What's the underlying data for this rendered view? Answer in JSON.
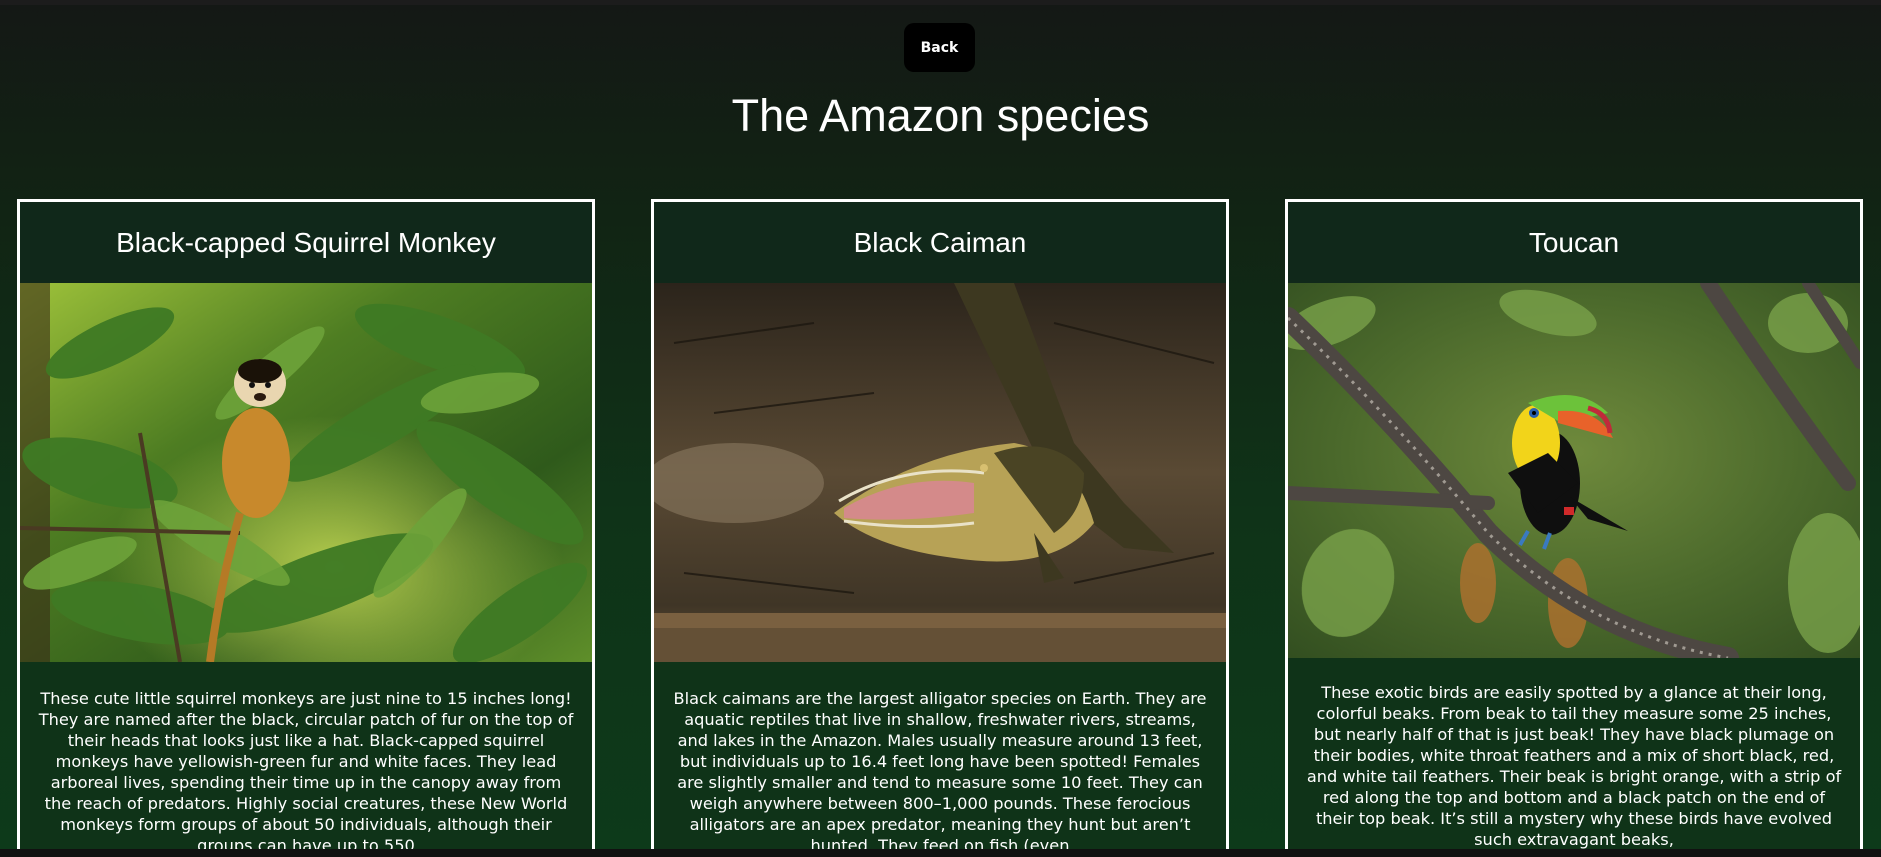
{
  "header": {
    "back_label": "Back",
    "title": "The Amazon species"
  },
  "cards": [
    {
      "title": "Black-capped Squirrel Monkey",
      "image": "squirrel-monkey-photo",
      "text": "These cute little squirrel monkeys are just nine to 15 inches long! They are named after the black, circular patch of fur on the top of their heads that looks just like a hat. Black-capped squirrel monkeys have yellowish-green fur and white faces. They lead arboreal lives, spending their time up in the canopy away from the reach of predators. Highly social creatures, these New World monkeys form groups of about 50 individuals, although their groups can have up to 550"
    },
    {
      "title": "Black Caiman",
      "image": "black-caiman-photo",
      "text": "Black caimans are the largest alligator species on Earth. They are aquatic reptiles that live in shallow, freshwater rivers, streams, and lakes in the Amazon. Males usually measure around 13 feet, but individuals up to 16.4 feet long have been spotted! Females are slightly smaller and tend to measure some 10 feet. They can weigh anywhere between 800–1,000 pounds. These ferocious alligators are an apex predator, meaning they hunt but aren’t hunted. They feed on fish (even"
    },
    {
      "title": "Toucan",
      "image": "toucan-photo",
      "text": "These exotic birds are easily spotted by a glance at their long, colorful beaks. From beak to tail they measure some 25 inches, but nearly half of that is just beak! They have black plumage on their bodies, white throat feathers and a mix of short black, red, and white tail feathers. Their beak is bright orange, with a strip of red along the top and bottom and a black patch on the end of their top beak. It’s still a mystery why these birds have evolved such extravagant beaks,"
    }
  ]
}
